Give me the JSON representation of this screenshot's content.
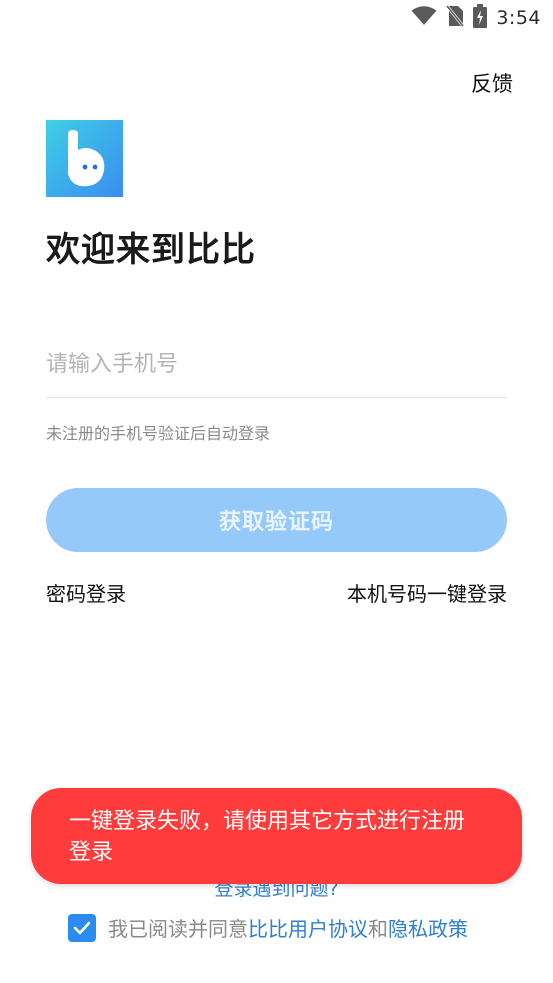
{
  "status_bar": {
    "time": "3:54",
    "icons": [
      "wifi-icon",
      "no-sim-icon",
      "battery-charging-icon"
    ]
  },
  "header": {
    "feedback_label": "反馈"
  },
  "app": {
    "logo_icon": "bibi-logo-icon",
    "welcome_title": "欢迎来到比比"
  },
  "form": {
    "phone_placeholder": "请输入手机号",
    "phone_value": "",
    "hint": "未注册的手机号验证后自动登录",
    "get_code_label": "获取验证码"
  },
  "alternatives": {
    "password_login": "密码登录",
    "one_click_login": "本机号码一键登录"
  },
  "footer": {
    "trouble_link": "登录遇到问题?",
    "agree_checked": true,
    "agree_prefix": "我已阅读并同意",
    "user_agreement": "比比用户协议",
    "and": "和",
    "privacy_policy": "隐私政策"
  },
  "toast": {
    "message": "一键登录失败，请使用其它方式进行注册登录"
  },
  "colors": {
    "accent": "#2b8cf0",
    "button_disabled": "#94c9fa",
    "toast_bg": "#ff3b3b",
    "link": "#2f7fd1"
  }
}
